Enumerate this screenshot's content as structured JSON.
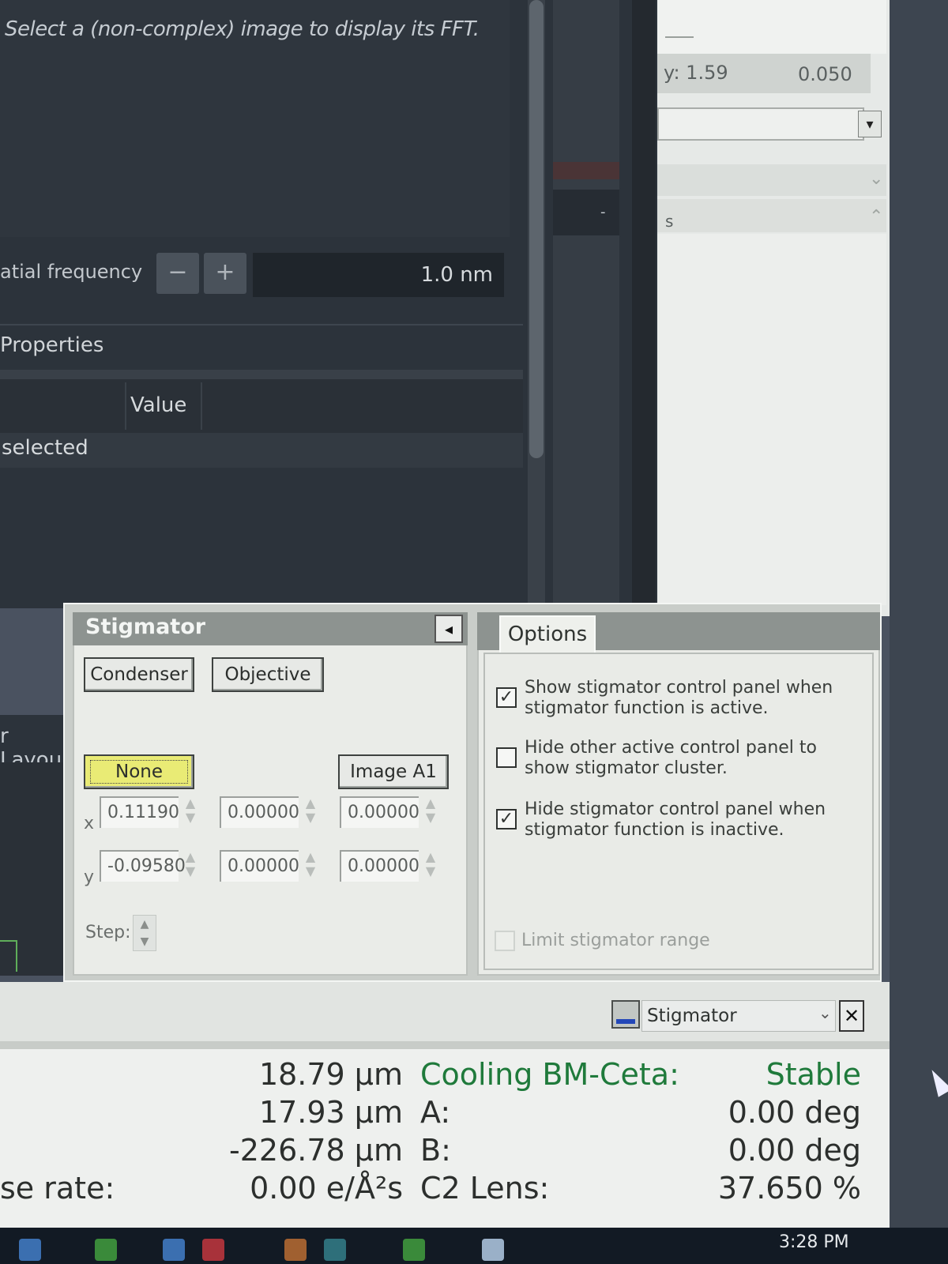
{
  "dark_app": {
    "fft_hint": "Select a (non-complex) image to display its FFT.",
    "spatial_frequency_label": "atial frequency",
    "minus_label": "−",
    "plus_label": "+",
    "spatial_frequency_value": "1.0 nm",
    "properties_title": "Properties",
    "properties_value_header": "Value",
    "properties_row_text": "selected",
    "layout_label": "r Layou",
    "mid_dash": "-"
  },
  "right_panel": {
    "readout_y": "y: 1.59",
    "readout_value": "0.050",
    "dropdown_arrow": "▾",
    "section_letter": "s",
    "chevron_down": "⌄",
    "chevron_up": "⌃"
  },
  "stigmator": {
    "title": "Stigmator",
    "collapse_glyph": "◂",
    "condenser_label": "Condenser",
    "objective_label": "Objective",
    "none_label": "None",
    "image_label": "Image A1",
    "x_label": "x",
    "y_label": "y",
    "x_values": [
      "0.11190",
      "0.00000",
      "0.00000"
    ],
    "y_values": [
      "-0.09580",
      "0.00000",
      "0.00000"
    ],
    "step_label": "Step:",
    "spin_glyph": "▲\n▼"
  },
  "options": {
    "tab_label": "Options",
    "check1_text": "Show stigmator control panel when stigmator function is active.",
    "check1_mark": "✓",
    "check2_text": "Hide other active control panel to show stigmator cluster.",
    "check2_mark": "",
    "check3_text": "Hide stigmator control panel when stigmator function is inactive.",
    "check3_mark": "✓",
    "check4_text": "Limit stigmator range",
    "check4_mark": ""
  },
  "control_bar": {
    "dropdown_value": "Stigmator",
    "dropdown_chevron": "⌄",
    "close_glyph": "✕",
    "accent_color": "#2348b8"
  },
  "status": {
    "values": [
      "18.79 µm",
      "17.93 µm",
      "-226.78 µm",
      "0.00 e/Å²s"
    ],
    "labels": [
      "Cooling BM-Ceta:",
      "A:",
      "B:",
      "C2 Lens:"
    ],
    "right_values": [
      "Stable",
      "0.00 deg",
      "0.00 deg",
      "37.650 %"
    ],
    "dose_label": "se rate:",
    "highlight_color": "#1f7a3b"
  },
  "taskbar": {
    "time": "3:28 PM"
  }
}
